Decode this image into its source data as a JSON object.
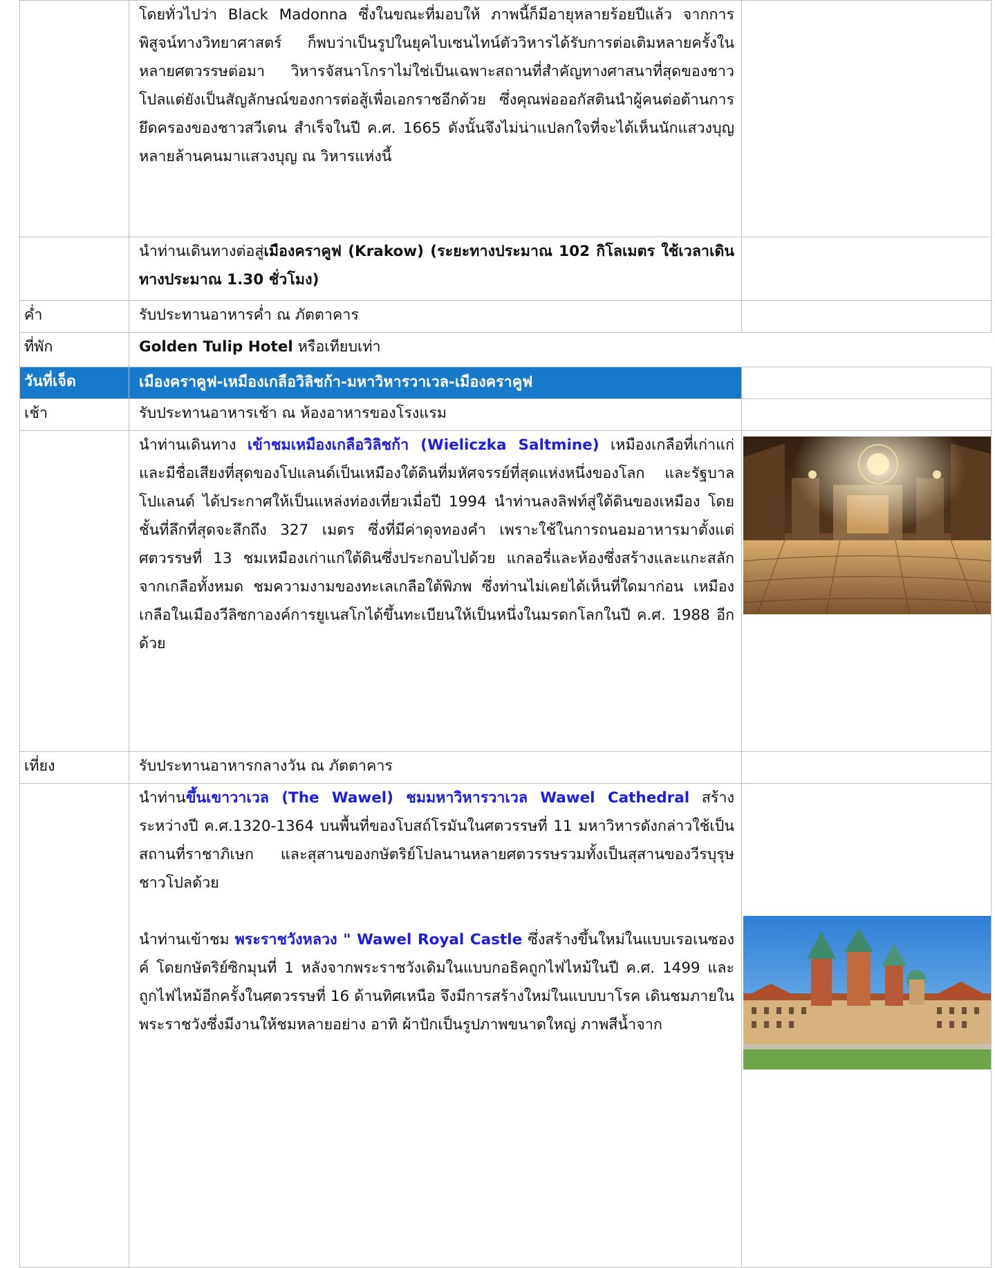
{
  "rows": {
    "intro_paragraph": "โดยทั่วไปว่า Black Madonna ซึ่งในขณะที่มอบให้ ภาพนี้ก็มีอายุหลายร้อยปีแล้ว จากการพิสูจน์ทางวิทยาศาสตร์ ก็พบว่าเป็นรูปในยุคไบเซนไทน์ตัววิหารได้รับการต่อเติมหลายครั้งในหลายศตวรรษต่อมา วิหารจัสนาโกราไม่ใช่เป็นเฉพาะสถานที่สำคัญทางศาสนาที่สุดของชาวโปลแต่ยังเป็นสัญลักษณ์ของการต่อสู้เพื่อเอกราชอีกด้วย ซึ่งคุณพ่อออกัสตินนำผู้คนต่อต้านการยึดครองของชาวสวีเดน สำเร็จในปี ค.ศ. 1665 ดังนั้นจึงไม่น่าแปลกใจที่จะได้เห็นนักแสวงบุญหลายล้านคนมาแสวงบุญ ณ วิหารแห่งนี้",
    "travel": {
      "prefix": "นำท่านเดินทางต่อสู่",
      "bold": "เมืองคราคูฟ (Krakow) (ระยะทางประมาณ 102 กิโลเมตร ใช้เวลาเดินทางประมาณ 1.30 ชั่วโมง)"
    },
    "dinner": {
      "label": "ค่ำ",
      "text": "รับประทานอาหารค่ำ ณ ภัตตาคาร"
    },
    "hotel": {
      "label": "ที่พัก",
      "name": "Golden Tulip Hotel",
      "suffix": " หรือเทียบเท่า"
    },
    "day_header": {
      "label": "วันที่เจ็ด",
      "title": "เมืองคราคูฟ-เหมืองเกลือวิลิชก้า-มหาวิหารวาเวล-เมืองคราคูฟ"
    },
    "breakfast": {
      "label": "เช้า",
      "text": "รับประทานอาหารเช้า ณ ห้องอาหารของโรงแรม"
    },
    "saltmine": {
      "prefix": "นำท่านเดินทาง ",
      "highlight": "เข้าชมเหมืองเกลือวิลิชก้า (Wieliczka Saltmine)",
      "body": " เหมืองเกลือที่เก่าแก่และมีชื่อเสียงที่สุดของโปแลนด์เป็นเหมืองใต้ดินที่มหัศจรรย์ที่สุดแห่งหนึ่งของโลก และรัฐบาลโปแลนด์ ได้ประกาศให้เป็นแหล่งท่องเที่ยวเมื่อปี 1994 นำท่านลงลิฟท์สู่ใต้ดินของเหมือง โดยชั้นที่ลึกที่สุดจะลึกถึง 327 เมตร ซึ่งที่มีค่าดุจทองคำ เพราะใช้ในการถนอมอาหารมาตั้งแต่ศตวรรษที่ 13 ชมเหมืองเก่าแก่ใต้ดินซึ่งประกอบไปด้วย แกลอรี่และห้องซึ่งสร้างและแกะสลักจากเกลือทั้งหมด ชมความงามของทะเลเกลือใต้พิภพ ซึ่งท่านไม่เคยได้เห็นที่ใดมาก่อน เหมืองเกลือในเมืองวีลิซกาองค์การยูเนสโกได้ขึ้นทะเบียนให้เป็นหนึ่งในมรดกโลกในปี ค.ศ. 1988 อีกด้วย"
    },
    "lunch": {
      "label": "เที่ยง",
      "text": "รับประทานอาหารกลางวัน ณ ภัตตาคาร"
    },
    "wawel": {
      "prefix": "นำท่าน",
      "highlight1": "ขึ้นเขาวาเวล (The Wawel) ชมมหาวิหารวาเวล Wawel Cathedral",
      "body1": " สร้างระหว่างปี ค.ศ.1320-1364 บนพื้นที่ของโบสถ์โรมันในศตวรรษที่ 11 มหาวิหารดังกล่าวใช้เป็นสถานที่ราชาภิเษก และสุสานของกษัตริย์โปลนานหลายศตวรรษรวมทั้งเป็นสุสานของวีรบุรุษชาวโปลด้วย",
      "prefix2": "นำท่านเข้าชม ",
      "highlight2": "พระราชวังหลวง \" Wawel Royal Castle",
      "body2": " ซึ่งสร้างขึ้นใหม่ในแบบเรอเนซองค์ โดยกษัตริย์ซิกมุนที่ 1 หลังจากพระราชวังเดิมในแบบกอธิคถูกไฟไหม้ในปี ค.ศ. 1499 และถูกไฟไหม้อีกครั้งในศตวรรษที่ 16 ด้านทิศเหนือ จึงมีการสร้างใหม่ในแบบบาโรค เดินชมภายในพระราชวังซึ่งมีงานให้ชมหลายอย่าง อาทิ ผ้าปักเป็นรูปภาพขนาดใหญ่ ภาพสีน้ำจาก"
    }
  },
  "colors": {
    "header_bg": "#1679c9",
    "highlight_text": "#1d1de0",
    "border": "#bfbfbf"
  }
}
